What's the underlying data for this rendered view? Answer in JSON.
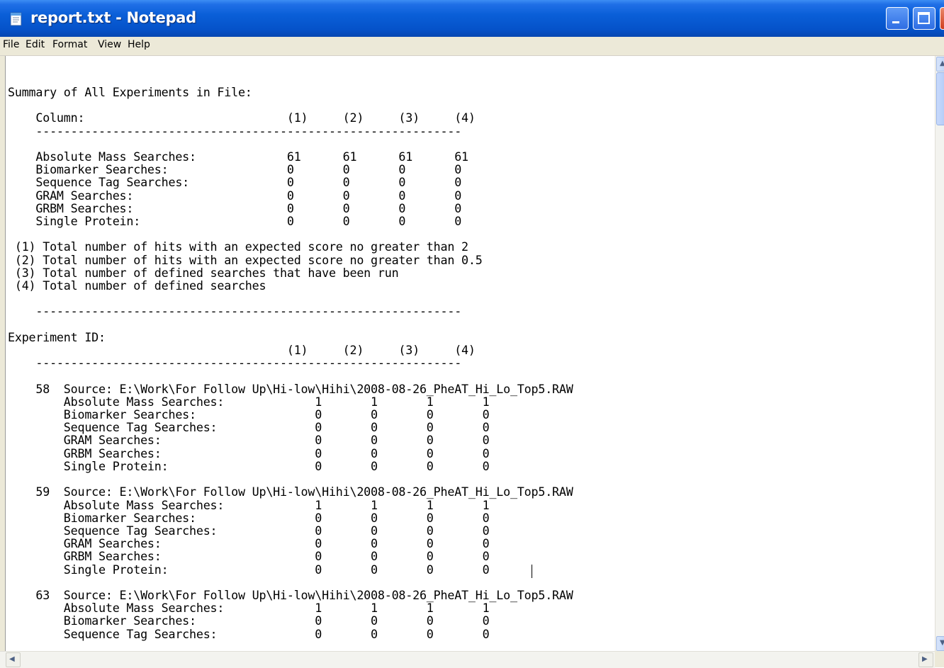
{
  "window": {
    "title": "report.txt - Notepad"
  },
  "menu": [
    "File",
    "Edit",
    "Format",
    "View",
    "Help"
  ],
  "icons": {
    "app": "notepad-icon",
    "minimize": "minimize-icon",
    "maximize": "maximize-icon",
    "close": "close-icon"
  },
  "colors": {
    "titlebar": "#0a5fd8",
    "close_button": "#cf3d1e",
    "menubar": "#ece9d8",
    "editor_bg": "#ffffff"
  },
  "document": {
    "text": "Summary of All Experiments in File:\n\n    Column:                             (1)     (2)     (3)     (4)\n    -------------------------------------------------------------\n\n    Absolute Mass Searches:             61      61      61      61\n    Biomarker Searches:                 0       0       0       0\n    Sequence Tag Searches:              0       0       0       0\n    GRAM Searches:                      0       0       0       0\n    GRBM Searches:                      0       0       0       0\n    Single Protein:                     0       0       0       0\n\n (1) Total number of hits with an expected score no greater than 2\n (2) Total number of hits with an expected score no greater than 0.5\n (3) Total number of defined searches that have been run\n (4) Total number of defined searches\n\n    -------------------------------------------------------------\n\nExperiment ID:\n                                        (1)     (2)     (3)     (4)\n    -------------------------------------------------------------\n\n    58  Source: E:\\Work\\For Follow Up\\Hi-low\\Hihi\\2008-08-26_PheAT_Hi_Lo_Top5.RAW\n        Absolute Mass Searches:             1       1       1       1\n        Biomarker Searches:                 0       0       0       0\n        Sequence Tag Searches:              0       0       0       0\n        GRAM Searches:                      0       0       0       0\n        GRBM Searches:                      0       0       0       0\n        Single Protein:                     0       0       0       0\n\n    59  Source: E:\\Work\\For Follow Up\\Hi-low\\Hihi\\2008-08-26_PheAT_Hi_Lo_Top5.RAW\n        Absolute Mass Searches:             1       1       1       1\n        Biomarker Searches:                 0       0       0       0\n        Sequence Tag Searches:              0       0       0       0\n        GRAM Searches:                      0       0       0       0\n        GRBM Searches:                      0       0       0       0\n        Single Protein:                     0       0       0       0\n\n    63  Source: E:\\Work\\For Follow Up\\Hi-low\\Hihi\\2008-08-26_PheAT_Hi_Lo_Top5.RAW\n        Absolute Mass Searches:             1       1       1       1\n        Biomarker Searches:                 0       0       0       0\n        Sequence Tag Searches:              0       0       0       0"
  }
}
